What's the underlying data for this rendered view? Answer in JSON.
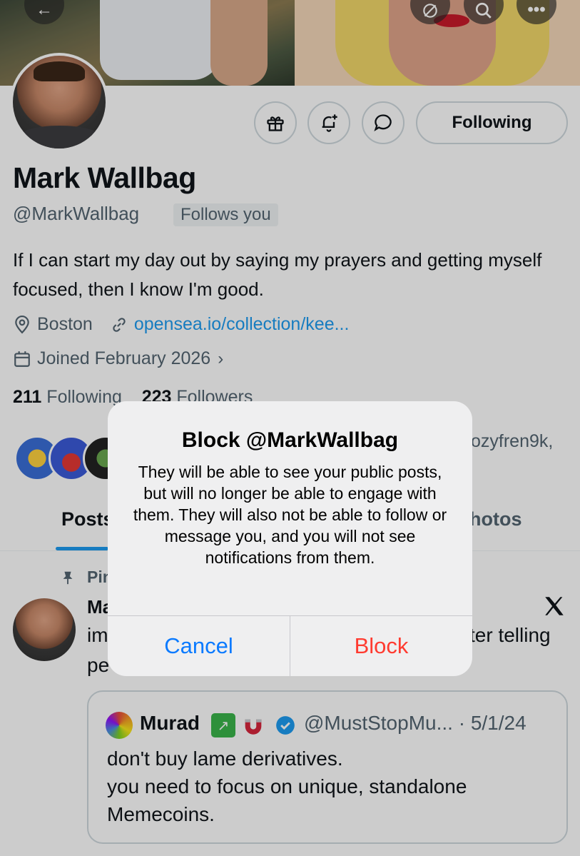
{
  "profile": {
    "name": "Mark Wallbag",
    "handle": "@MarkWallbag",
    "follows_you": "Follows you",
    "bio": "If I can start my day out by saying my prayers and getting myself focused, then I know I'm good.",
    "location": "Boston",
    "website": "opensea.io/collection/kee...",
    "joined": "Joined February 2026",
    "following_count": "211",
    "following_label": "Following",
    "followers_count": "223",
    "followers_label": "Followers",
    "followed_by_fragment": "ozyfren9k,"
  },
  "actions": {
    "following_button": "Following"
  },
  "tabs": [
    {
      "label": "Posts"
    },
    {
      "label": "Photos"
    }
  ],
  "pinned_post": {
    "pinned_label": "Pinned",
    "author": "Mark Wallbag",
    "text_line1_start": "im",
    "text_line1_end": "ter telling",
    "text_line2": "pe"
  },
  "quoted_post": {
    "author": "Murad",
    "handle_date": "@MustStopMu... · 5/1/24",
    "text": "don't buy lame derivatives.\nyou need to focus on unique, standalone Memecoins."
  },
  "dialog": {
    "title": "Block @MarkWallbag",
    "message": "They will be able to see your public posts, but will no longer be able to engage with them. They will also not be able to follow or message you, and you will not see notifications from them.",
    "cancel_label": "Cancel",
    "block_label": "Block"
  },
  "colors": {
    "link": "#1d9bf0",
    "dialog_cancel": "#0a7aff",
    "dialog_destructive": "#ff3b30"
  }
}
